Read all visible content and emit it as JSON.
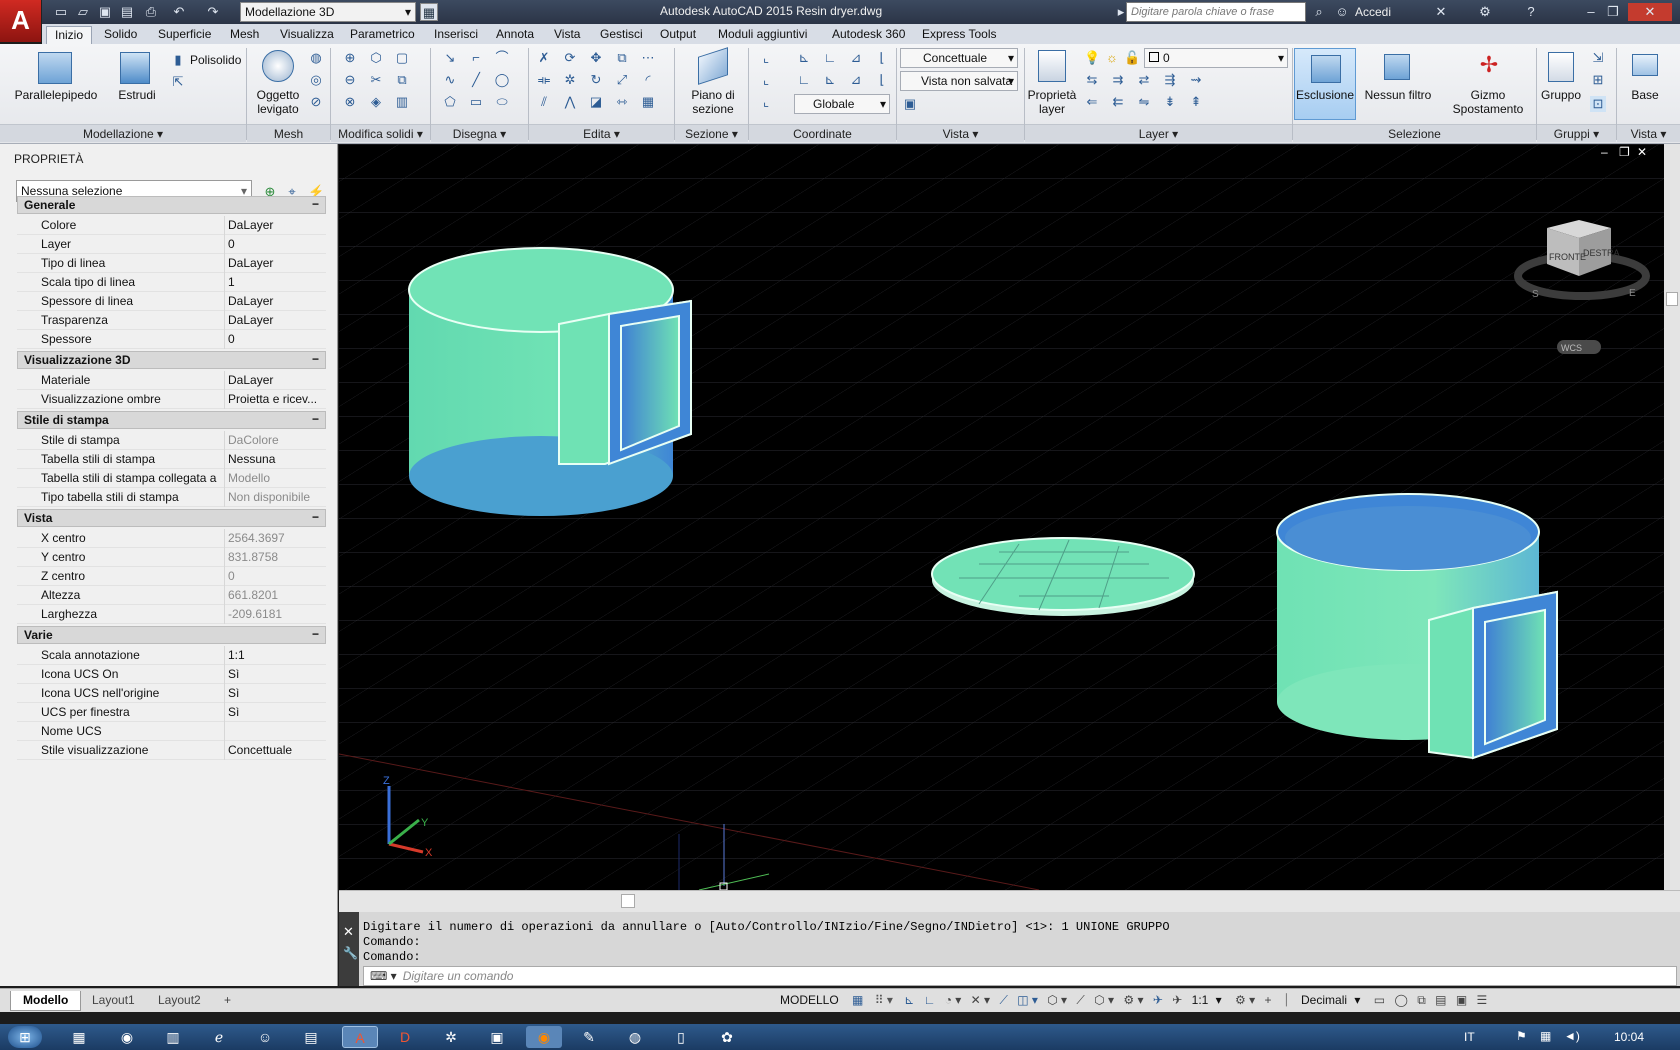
{
  "titlebar": {
    "workspace": "Modellazione 3D",
    "window_title": "Autodesk AutoCAD 2015    Resin dryer.dwg",
    "search_placeholder": "Digitare parola chiave o frase",
    "signin": "Accedi"
  },
  "tabs": [
    "Inizio",
    "Solido",
    "Superficie",
    "Mesh",
    "Visualizza",
    "Parametrico",
    "Inserisci",
    "Annota",
    "Vista",
    "Gestisci",
    "Output",
    "Moduli aggiuntivi",
    "Autodesk 360",
    "Express Tools"
  ],
  "ribbon": {
    "parallelepipedo": "Parallelepipedo",
    "estrudi": "Estrudi",
    "polisolido": "Polisolido",
    "oggetto_levigato": "Oggetto\nlevigato",
    "piano_sezione": "Piano di\nsezione",
    "visual_style": "Concettuale",
    "named_view": "Vista non salvata",
    "coord": "Globale",
    "layer_value": "0",
    "proprieta_layer": "Proprietà\nlayer",
    "esclusione": "Esclusione",
    "nessun_filtro": "Nessun filtro",
    "gizmo": "Gizmo\nSpostamento",
    "gruppo": "Gruppo",
    "base": "Base",
    "panels": [
      "Modellazione",
      "Mesh",
      "Modifica solidi",
      "Disegna",
      "Edita",
      "Sezione",
      "Coordinate",
      "Vista",
      "Layer",
      "Selezione",
      "Gruppi",
      "Vista"
    ]
  },
  "properties": {
    "title": "PROPRIETÀ",
    "selection": "Nessuna selezione",
    "sections": [
      {
        "name": "Generale",
        "rows": [
          [
            "Colore",
            "DaLayer"
          ],
          [
            "Layer",
            "0"
          ],
          [
            "Tipo di linea",
            "DaLayer"
          ],
          [
            "Scala tipo di linea",
            "1"
          ],
          [
            "Spessore di linea",
            "DaLayer"
          ],
          [
            "Trasparenza",
            "DaLayer"
          ],
          [
            "Spessore",
            "0"
          ]
        ]
      },
      {
        "name": "Visualizzazione 3D",
        "rows": [
          [
            "Materiale",
            "DaLayer"
          ],
          [
            "Visualizzazione ombre",
            "Proietta e ricev..."
          ]
        ]
      },
      {
        "name": "Stile di stampa",
        "rows": [
          [
            "Stile di stampa",
            "DaColore"
          ],
          [
            "Tabella stili di stampa",
            "Nessuna"
          ],
          [
            "Tabella stili di stampa collegata a",
            "Modello"
          ],
          [
            "Tipo tabella stili di stampa",
            "Non disponibile"
          ]
        ]
      },
      {
        "name": "Vista",
        "rows": [
          [
            "X centro",
            "2564.3697"
          ],
          [
            "Y centro",
            "831.8758"
          ],
          [
            "Z centro",
            "0"
          ],
          [
            "Altezza",
            "661.8201"
          ],
          [
            "Larghezza",
            "-209.6181"
          ]
        ]
      },
      {
        "name": "Varie",
        "rows": [
          [
            "Scala annotazione",
            "1:1"
          ],
          [
            "Icona UCS On",
            "Sì"
          ],
          [
            "Icona UCS nell'origine",
            "Sì"
          ],
          [
            "UCS per finestra",
            "Sì"
          ],
          [
            "Nome UCS",
            ""
          ],
          [
            "Stile visualizzazione",
            "Concettuale"
          ]
        ]
      }
    ]
  },
  "viewcube": {
    "front": "FRONTE",
    "right": "DESTRA",
    "wcs": "WCS",
    "south": "S",
    "east": "E"
  },
  "command": {
    "history": [
      "Digitare il numero di operazioni da annullare o [Auto/Controllo/INIzio/Fine/Segno/INDietro] <1>: 1 UNIONE GRUPPO",
      "Comando:",
      "Comando:"
    ],
    "placeholder": "Digitare un comando"
  },
  "layouts": [
    "Modello",
    "Layout1",
    "Layout2"
  ],
  "status": {
    "mode": "MODELLO",
    "scale": "1:1",
    "units": "Decimali"
  },
  "taskbar": {
    "lang": "IT",
    "time": "10:04"
  },
  "colors": {
    "solid": "#6fe2b4",
    "solid_shade": "#3f86d6",
    "accent": "#c8201a"
  }
}
